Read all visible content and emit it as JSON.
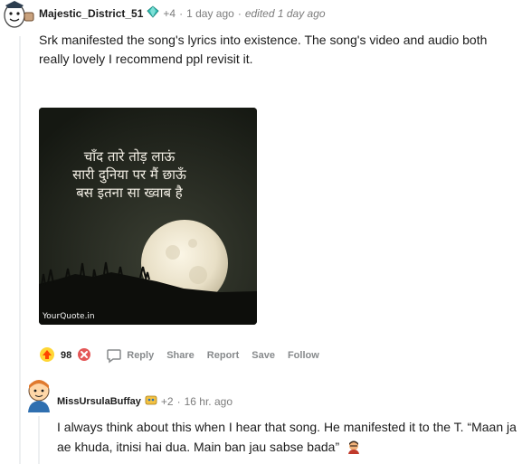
{
  "comment1": {
    "author": "Majestic_District_51",
    "award_count": "+4",
    "separator": "·",
    "time": "1 day ago",
    "edited": "edited 1 day ago",
    "body": "Srk manifested the song's lyrics into existence. The song's video and audio both really lovely I recommend ppl revisit it.",
    "image": {
      "poem_lines": [
        "चाँद तारे तोड़ लाऊं",
        "सारी दुनिया पर मैं छाऊँ",
        "बस इतना सा ख्वाब है"
      ],
      "watermark": "YourQuote.in"
    },
    "score": "98",
    "actions": {
      "reply": "Reply",
      "share": "Share",
      "report": "Report",
      "save": "Save",
      "follow": "Follow"
    }
  },
  "comment2": {
    "author": "MissUrsulaBuffay",
    "award_count": "+2",
    "separator": "·",
    "time": "16 hr. ago",
    "body": "I always think about this when I hear that song. He manifested it to the T. “Maan ja ae khuda, itnisi hai dua. Main ban jau sabse bada”"
  },
  "colors": {
    "upvote": "#ff4500",
    "meta": "#7c7c7c",
    "action": "#878a8c"
  }
}
